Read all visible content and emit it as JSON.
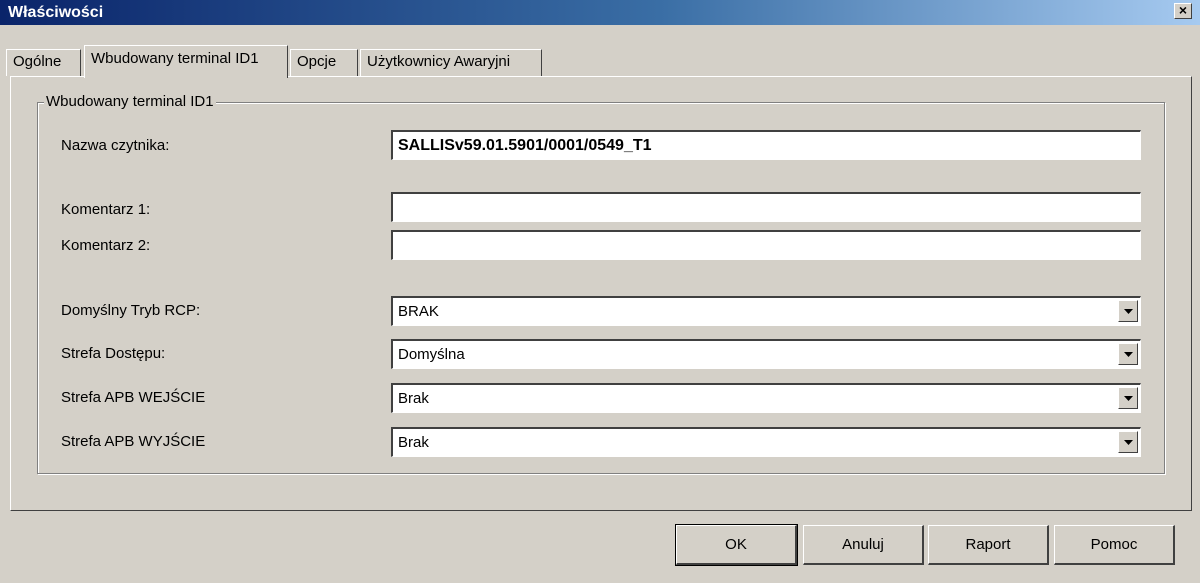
{
  "window": {
    "title": "Właściwości",
    "close_label": "×"
  },
  "tabs": [
    {
      "label": "Ogólne"
    },
    {
      "label": "Wbudowany terminal ID1"
    },
    {
      "label": "Opcje"
    },
    {
      "label": "Użytkownicy Awaryjni"
    }
  ],
  "group": {
    "title": "Wbudowany terminal ID1"
  },
  "fields": {
    "reader_name": {
      "label": "Nazwa czytnika:",
      "value": "SALLISv59.01.5901/0001/0549_T1"
    },
    "comment1": {
      "label": "Komentarz 1:",
      "value": ""
    },
    "comment2": {
      "label": "Komentarz 2:",
      "value": ""
    },
    "rcp_mode": {
      "label": "Domyślny Tryb RCP:",
      "value": "BRAK"
    },
    "access_zone": {
      "label": "Strefa Dostępu:",
      "value": "Domyślna"
    },
    "apb_in": {
      "label": "Strefa APB WEJŚCIE",
      "value": "Brak"
    },
    "apb_out": {
      "label": "Strefa APB WYJŚCIE",
      "value": "Brak"
    }
  },
  "buttons": {
    "ok": "OK",
    "cancel": "Anuluj",
    "report": "Raport",
    "help": "Pomoc"
  }
}
